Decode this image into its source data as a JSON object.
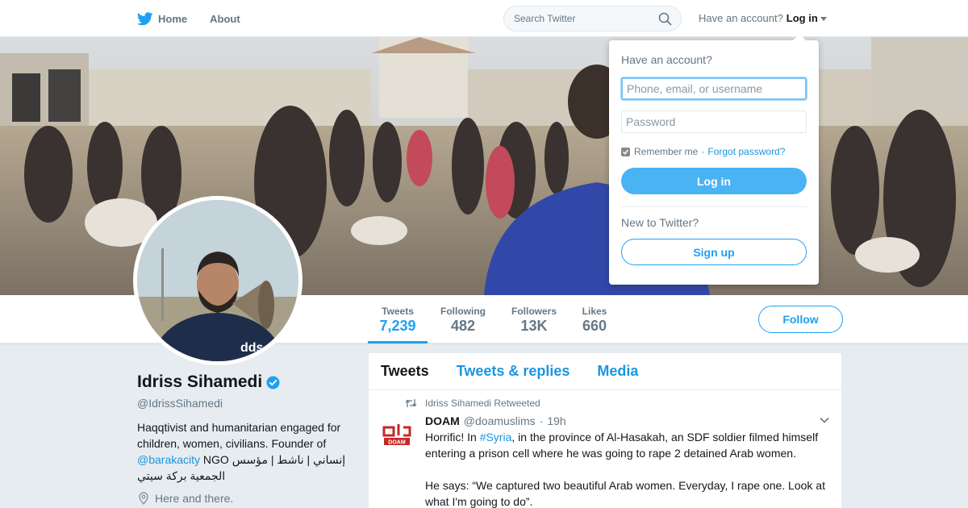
{
  "nav": {
    "home_label": "Home",
    "about_label": "About",
    "search_placeholder": "Search Twitter",
    "have_account": "Have an account?",
    "login_label": "Log in"
  },
  "profile": {
    "name": "Idriss Sihamedi",
    "handle": "@IdrissSihamedi",
    "bio_line1": "Haqqtivist and humanitarian engaged for",
    "bio_line2": "children, women, civilians. Founder of",
    "bio_link": "@barakacity",
    "bio_line3_rest": " NGO إنساني | ناشط | مؤسس",
    "bio_line4": "الجمعية بركة سيتي",
    "location": "Here and there."
  },
  "stats": [
    {
      "label": "Tweets",
      "value": "7,239"
    },
    {
      "label": "Following",
      "value": "482"
    },
    {
      "label": "Followers",
      "value": "13K"
    },
    {
      "label": "Likes",
      "value": "660"
    }
  ],
  "follow_label": "Follow",
  "timeline": {
    "tabs": [
      "Tweets",
      "Tweets & replies",
      "Media"
    ],
    "retweet_context": "Idriss Sihamedi Retweeted",
    "tweet": {
      "avatar_text": "DOAM",
      "name": "DOAM",
      "handle": "@doamuslims",
      "time": "19h",
      "text_pre": "Horrific! In ",
      "hashtag": "#Syria",
      "text_post": ", in the province of Al-Hasakah, an SDF soldier filmed himself entering a prison cell where he was going to rape 2 detained Arab women.\n\nHe says: “We captured two beautiful Arab women. Everyday, I rape one. Look at what I'm going to do”."
    }
  },
  "login_dropdown": {
    "title": "Have an account?",
    "username_placeholder": "Phone, email, or username",
    "password_placeholder": "Password",
    "remember_label": "Remember me",
    "separator": "·",
    "forgot_label": "Forgot password?",
    "login_button": "Log in",
    "new_to_twitter": "New to Twitter?",
    "signup_button": "Sign up"
  },
  "colors": {
    "accent": "#1da1f2",
    "link": "#1b95e0",
    "login_button": "#4ab3f4",
    "background": "#e6ecf0"
  }
}
